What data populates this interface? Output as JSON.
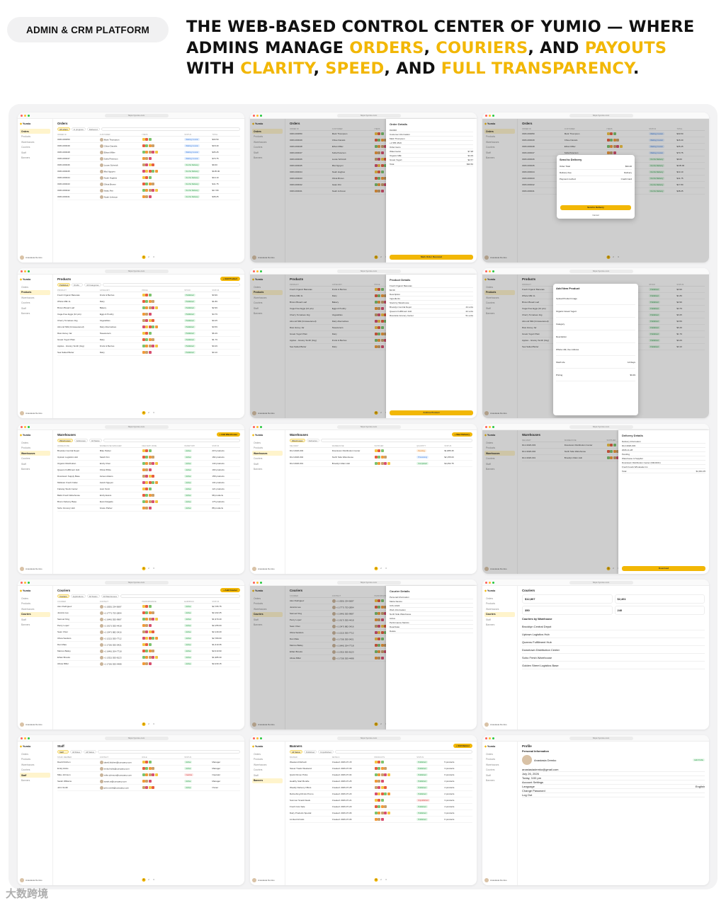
{
  "badge": "ADMIN & CRM PLATFORM",
  "headline": {
    "parts": [
      {
        "text": "THE WEB-BASED CONTROL CENTER OF YUMIO — WHERE ADMINS MANAGE ",
        "hl": false
      },
      {
        "text": "ORDERS",
        "hl": true
      },
      {
        "text": ", ",
        "hl": false
      },
      {
        "text": "COURIERS",
        "hl": true
      },
      {
        "text": ", AND ",
        "hl": false
      },
      {
        "text": "PAYOUTS",
        "hl": true
      },
      {
        "text": " WITH ",
        "hl": false
      },
      {
        "text": "CLARITY",
        "hl": true
      },
      {
        "text": ", ",
        "hl": false
      },
      {
        "text": "SPEED",
        "hl": true
      },
      {
        "text": ", AND ",
        "hl": false
      },
      {
        "text": "FULL TRANSPARENCY",
        "hl": true
      },
      {
        "text": ".",
        "hl": false
      }
    ]
  },
  "colors": {
    "accent": "#f2b705",
    "canvas": "#f3f3f4"
  },
  "app": {
    "logo": "Yumio",
    "url": "https://yumio.com",
    "nav": [
      "Orders",
      "Products",
      "Warehouses",
      "Couriers",
      "Staff",
      "Banners"
    ],
    "user_name": "Anastasia Demko",
    "pages": [
      "1",
      "2",
      "3"
    ],
    "selected_page": "1"
  },
  "screens": [
    {
      "title": "Orders",
      "nav": "Orders",
      "kind": "table",
      "filters": [
        "All orders",
        "In progress",
        "Delivered"
      ],
      "columns": [
        "ORDER ID",
        "CUSTOMER",
        "ITEMS",
        "STATUS",
        "TOTAL"
      ],
      "rows": [
        {
          "c1": "ORD-000050",
          "c2": "Mark Thompson",
          "status": "Waiting Courier",
          "tone": "blue",
          "total": "$30.50"
        },
        {
          "c1": "ORD-000049",
          "c2": "Chloe Daniels",
          "status": "Waiting Courier",
          "tone": "blue",
          "total": "$18.40"
        },
        {
          "c1": "ORD-000048",
          "c2": "Ethan Miller",
          "status": "Waiting Courier",
          "tone": "blue",
          "total": "$35.25"
        },
        {
          "c1": "ORD-000047",
          "c2": "Sofia Peterson",
          "status": "Waiting Courier",
          "tone": "blue",
          "total": "$70.75"
        },
        {
          "c1": "ORD-000046",
          "c2": "Lucas Schmidt",
          "status": "Out for Delivery",
          "tone": "green",
          "total": "$9.60"
        },
        {
          "c1": "ORD-000045",
          "c2": "Mia Nguyen",
          "status": "Out for Delivery",
          "tone": "green",
          "total": "$105.00"
        },
        {
          "c1": "ORD-000044",
          "c2": "Noah Hughes",
          "status": "Out for Delivery",
          "tone": "green",
          "total": "$19.10"
        },
        {
          "c1": "ORD-000043",
          "c2": "Olivia Brown",
          "status": "Out for Delivery",
          "tone": "green",
          "total": "$41.75"
        },
        {
          "c1": "ORD-000042",
          "c2": "Isaac Ahn",
          "status": "Out for Delivery",
          "tone": "green",
          "total": "$17.80"
        },
        {
          "c1": "ORD-000041",
          "c2": "Noah Johnson",
          "status": "Out for Delivery",
          "tone": "green",
          "total": "$38.25"
        }
      ]
    },
    {
      "title": "Orders",
      "nav": "Orders",
      "kind": "panel",
      "panel_title": "Order Details",
      "panel_lines": [
        "#12040",
        "Customer Information",
        "Mark Thompson",
        "+1 555 4519",
        "Order items",
        "Watermelon",
        "Organic Milk",
        "Greek Yogurt",
        "Total"
      ],
      "panel_values": [
        "",
        "",
        "",
        "",
        "",
        "$7.98",
        "$4.29",
        "$2.67",
        "$30.50"
      ],
      "panel_button": "Mark Order Received"
    },
    {
      "title": "Orders",
      "nav": "Orders",
      "kind": "modal",
      "modal_title": "Send to Delivery",
      "modal_lines": [
        "Order Total",
        "Delivery Fee",
        "Payment method"
      ],
      "modal_values": [
        "$34.20",
        "Delivery",
        "Credit Card"
      ],
      "modal_button": "Send to Delivery",
      "modal_cancel": "Cancel"
    },
    {
      "title": "Products",
      "nav": "Products",
      "kind": "table",
      "button": "+ Add Product",
      "filters": [
        "Published",
        "Drafts",
        "All Categories"
      ],
      "columns": [
        "PRODUCT",
        "CATEGORY",
        "PRICE",
        "STOCK",
        "STATUS"
      ],
      "rows": [
        {
          "c1": "Fresh Organic Bananas",
          "c2": "Fruits & Berries",
          "status": "Published",
          "tone": "green",
          "total": "$3.99"
        },
        {
          "c1": "Whole Milk 1L",
          "c2": "Dairy",
          "status": "Published",
          "tone": "green",
          "total": "$1.89"
        },
        {
          "c1": "Brown Bread Loaf",
          "c2": "Bakery",
          "status": "Published",
          "tone": "green",
          "total": "$2.99"
        },
        {
          "c1": "Cage-Free Eggs (12 pcs)",
          "c2": "Eggs & Poultry",
          "status": "Published",
          "tone": "green",
          "total": "$4.79"
        },
        {
          "c1": "Cherry Tomatoes 1kg",
          "c2": "Vegetables",
          "status": "Published",
          "tone": "green",
          "total": "$3.25"
        },
        {
          "c1": "Almond Milk (Unsweetened)",
          "c2": "Dairy Alternatives",
          "status": "Published",
          "tone": "green",
          "total": "$3.59"
        },
        {
          "c1": "Raw Honey Jar",
          "c2": "Sweeteners",
          "status": "Published",
          "tone": "green",
          "total": "$6.49"
        },
        {
          "c1": "Greek Yogurt Plain",
          "c2": "Dairy",
          "status": "Published",
          "tone": "green",
          "total": "$1.79"
        },
        {
          "c1": "Apples - Granny Smith (1kg)",
          "c2": "Fruits & Berries",
          "status": "Published",
          "tone": "green",
          "total": "$3.29"
        },
        {
          "c1": "Sea Salted Butter",
          "c2": "Dairy",
          "status": "Published",
          "tone": "green",
          "total": "$3.10"
        }
      ]
    },
    {
      "title": "Products",
      "nav": "Products",
      "kind": "panel",
      "panel_title": "Product Details",
      "panel_lines": [
        "Fresh Organic Bananas",
        "$3.99",
        "Description",
        "Ingredients",
        "Stock by Warehouse",
        "Brooklyn Central Depot",
        "Queens Fulfillment Hub",
        "Riverside Grocery Center"
      ],
      "panel_values": [
        "",
        "",
        "",
        "",
        "",
        "44 units",
        "22 units",
        "51 units"
      ],
      "panel_button": "Archive Product"
    },
    {
      "title": "Products",
      "nav": "Products",
      "kind": "modal",
      "modal_title": "Add New Product",
      "modal_lines": [
        "Upload Product Image",
        "Organic Greek Yogurt",
        "Category",
        "Description",
        "Whole milk, live cultures",
        "Shelf Life",
        "Pricing"
      ],
      "modal_values": [
        "",
        "",
        "",
        "",
        "",
        "14 Days",
        "$3.49"
      ],
      "modal_button": "",
      "modal_cancel": ""
    },
    {
      "title": "Warehouses",
      "nav": "Warehouses",
      "kind": "table",
      "button": "+ Add Warehouse",
      "filters": [
        "Warehouses",
        "Addresses",
        "All Status"
      ],
      "columns": [
        "WAREHOUSE",
        "WAREHOUSE MANAGER",
        "DELIVERY ZONE",
        "INVENTORY",
        "STATUS"
      ],
      "rows": [
        {
          "c1": "Brooklyn Central Depot",
          "c2": "Mike Parker",
          "status": "Active",
          "tone": "green",
          "total": "215 products"
        },
        {
          "c1": "Uptown Logistics Hub",
          "c2": "Sarah Kim",
          "status": "Active",
          "tone": "green",
          "total": "182 products"
        },
        {
          "c1": "Organic Distribution",
          "c2": "Emily Chen",
          "status": "Active",
          "tone": "green",
          "total": "140 products"
        },
        {
          "c1": "Queens Fulfillment Hub",
          "c2": "Olivia White",
          "status": "Active",
          "tone": "green",
          "total": "190 products"
        },
        {
          "c1": "Downtown Supply Base",
          "c2": "James Adams",
          "status": "Active",
          "tone": "green",
          "total": "158 products"
        },
        {
          "c1": "Midtown Fresh Outlet",
          "c2": "Jacob Nguyen",
          "status": "Active",
          "tone": "green",
          "total": "134 products"
        },
        {
          "c1": "Fairway Stock Center",
          "c2": "Liam Scott",
          "status": "Active",
          "tone": "green",
          "total": "121 products"
        },
        {
          "c1": "Baltic Fresh Warehouse",
          "c2": "Emily Evans",
          "status": "Active",
          "tone": "green",
          "total": "98 products"
        },
        {
          "c1": "Bronx Delivery Base",
          "c2": "Evan Delgado",
          "status": "Active",
          "tone": "green",
          "total": "176 products"
        },
        {
          "c1": "Soho Grocery Hub",
          "c2": "Grace Parker",
          "status": "Active",
          "tone": "green",
          "total": "88 products"
        }
      ]
    },
    {
      "title": "Warehouses",
      "nav": "Warehouses",
      "kind": "table",
      "button": "+ New Delivery",
      "filters": [
        "Warehouses",
        "Deliveries"
      ],
      "columns": [
        "DELIVERY",
        "WAREHOUSE",
        "SUPPLIER",
        "QUANTITY",
        "STATUS"
      ],
      "rows": [
        {
          "c1": "DLV-2026-003",
          "c2": "Downtown Distribution Center",
          "status": "Pending",
          "tone": "orng",
          "total": "$1,885.35"
        },
        {
          "c1": "DLV-2026-002",
          "c2": "North Side Warehouse",
          "status": "Processing",
          "tone": "blue",
          "total": "$2,155.00"
        },
        {
          "c1": "DLV-2026-001",
          "c2": "Brooklyn Main Hub",
          "status": "Completed",
          "tone": "green",
          "total": "$4,452.75"
        }
      ]
    },
    {
      "title": "Warehouses",
      "nav": "Warehouses",
      "kind": "panel",
      "panel_title": "Delivery Details",
      "panel_lines": [
        "Delivery Information",
        "DLV-2026-003",
        "2026-11-28",
        "Pending",
        "Warehouse & Supplier",
        "Downtown Distribution Center (NM-DDC)",
        "Fresh Foods Wholesale Inc.",
        "Total"
      ],
      "panel_values": [
        "",
        "",
        "",
        "",
        "",
        "",
        "",
        "$1,931.05"
      ],
      "panel_button": "Download"
    },
    {
      "title": "Couriers",
      "nav": "Couriers",
      "kind": "table",
      "button": "+ Add Courier",
      "filters": [
        "Couriers",
        "Applications",
        "All Status",
        "All Warehouses"
      ],
      "columns": [
        "COURIER",
        "CONTACT",
        "PERFORMANCE",
        "EARNINGS",
        "STATUS"
      ],
      "rows": [
        {
          "c1": "Alex Rodriguez",
          "c2": "+1 (555) 234-5687",
          "status": "Active",
          "tone": "green",
          "total": "$2,765.75"
        },
        {
          "c1": "Jessica Lee",
          "c2": "+1 (777) 753-2894",
          "status": "Active",
          "tone": "green",
          "total": "$2,102.25"
        },
        {
          "c1": "Samuel King",
          "c2": "+1 (646) 555-9987",
          "status": "Active",
          "tone": "green",
          "total": "$1,970.40"
        },
        {
          "c1": "Percy Lopez",
          "c2": "+1 (917) 555-4418",
          "status": "Active",
          "tone": "green",
          "total": "$2,155.00"
        },
        {
          "c1": "Sean Chen",
          "c2": "+1 (347) 882-3416",
          "status": "Active",
          "tone": "green",
          "total": "$2,140.20"
        },
        {
          "c1": "Olivia Sanders",
          "c2": "+1 (212) 555-7712",
          "status": "Active",
          "tone": "green",
          "total": "$2,780.60"
        },
        {
          "c1": "Dan Maia",
          "c2": "+1 (718) 555-0421",
          "status": "Active",
          "tone": "green",
          "total": "$1,610.35"
        },
        {
          "c1": "Marcus Bailey",
          "c2": "+1 (646) 204-7718",
          "status": "Active",
          "tone": "green",
          "total": "$2,010.90"
        },
        {
          "c1": "Ethan Brooks",
          "c2": "+1 (332) 555-8123",
          "status": "Active",
          "tone": "green",
          "total": "$1,985.30"
        },
        {
          "c1": "Alissa Miller",
          "c2": "+1 (718) 555-4488",
          "status": "Active",
          "tone": "green",
          "total": "$2,230.15"
        }
      ]
    },
    {
      "title": "Couriers",
      "nav": "Couriers",
      "kind": "panel",
      "panel_title": "Courier Details",
      "panel_lines": [
        "Personal Information",
        "Marta Santos",
        "COU-1024",
        "Work Information",
        "North Side Warehouse",
        "Active",
        "Performance Metrics",
        "Deactivate",
        "Delete"
      ],
      "panel_values": [
        "",
        "",
        "",
        "",
        "",
        "",
        "",
        "",
        ""
      ],
      "panel_button": ""
    },
    {
      "title": "Couriers",
      "nav": "Couriers",
      "kind": "cards",
      "cards": [
        "$12,807",
        "$2,461",
        "350",
        "240"
      ],
      "list_title": "Couriers by Warehouse",
      "list": [
        "Brooklyn Central Depot",
        "Uptown Logistics Hub",
        "Queens Fulfillment Hub",
        "Downtown Distribution Center",
        "Soho Fresh Warehouse",
        "Golden Street Logistics Base"
      ]
    },
    {
      "title": "Staff",
      "nav": "Staff",
      "kind": "table",
      "filters": [
        "Staff",
        "All Roles",
        "All Status"
      ],
      "columns": [
        "STAFF MEMBER",
        "CONTACT",
        "ROLE",
        "STATUS"
      ],
      "rows": [
        {
          "c1": "David Kitchen",
          "c2": "david.kitchen@company.com",
          "status": "Active",
          "tone": "green",
          "total": "Manager"
        },
        {
          "c1": "Emily Hicks",
          "c2": "emily.hicks@company.com",
          "status": "Active",
          "tone": "green",
          "total": "Manager"
        },
        {
          "c1": "Mike Johnson",
          "c2": "mike.johnson@company.com",
          "status": "Inactive",
          "tone": "red",
          "total": "Operator"
        },
        {
          "c1": "Sarah Williams",
          "c2": "sarah.w@company.com",
          "status": "Active",
          "tone": "green",
          "total": "Manager"
        },
        {
          "c1": "John Smith",
          "c2": "john.smith@company.com",
          "status": "Active",
          "tone": "green",
          "total": "Owner"
        }
      ]
    },
    {
      "title": "Banners",
      "nav": "Banners",
      "kind": "table",
      "button": "+ Add Banner",
      "filters": [
        "All Status",
        "Published",
        "Unpublished"
      ],
      "columns": [
        "BANNER",
        "DETAILS",
        "PRODUCTS",
        "STATUS"
      ],
      "rows": [
        {
          "c1": "Weekend Refresh",
          "c2": "Created: 2026-07-15",
          "status": "Published",
          "tone": "green",
          "total": "5 products"
        },
        {
          "c1": "Sweet Treats Weekend",
          "c2": "Created: 2026-07-09",
          "status": "Published",
          "tone": "green",
          "total": "3 products"
        },
        {
          "c1": "Quick Dinner Picks",
          "c2": "Created: 2026-07-04",
          "status": "Published",
          "tone": "green",
          "total": "6 products"
        },
        {
          "c1": "Healthy Start Bundle",
          "c2": "Created: 2026-07-25",
          "status": "Published",
          "tone": "green",
          "total": "4 products"
        },
        {
          "c1": "Weekly Delivery Offers",
          "c2": "Created: 2026-07-28",
          "status": "Published",
          "tone": "green",
          "total": "4 products"
        },
        {
          "c1": "Refreshing Drinks Promo",
          "c2": "Created: 2026-07-23",
          "status": "Published",
          "tone": "green",
          "total": "2 products"
        },
        {
          "c1": "Summer Snack Deals",
          "c2": "Created: 2026-07-21",
          "status": "Unpublished",
          "tone": "red",
          "total": "3 products"
        },
        {
          "c1": "Fresh Cuts Sale",
          "c2": "Created: 2026-07-20",
          "status": "Published",
          "tone": "green",
          "total": "4 products"
        },
        {
          "c1": "Dairy Products Special",
          "c2": "Created: 2026-07-06",
          "status": "Published",
          "tone": "green",
          "total": "3 products"
        },
        {
          "c1": "Limited Arrivals",
          "c2": "Created: 2026-07-06",
          "status": "Published",
          "tone": "green",
          "total": "6 products"
        }
      ]
    },
    {
      "title": "Profile",
      "nav": "",
      "kind": "profile",
      "name": "Anastasia Demko",
      "edit": "Edit Profile",
      "lines": [
        "Personal Information",
        "anastasiademko@gmail.com",
        "July 26, 2026",
        "Today, 3:00 pm",
        "Account Settings",
        "Language",
        "Change Password",
        "Log Out"
      ],
      "language": "English"
    }
  ],
  "watermark": "大数跨境"
}
